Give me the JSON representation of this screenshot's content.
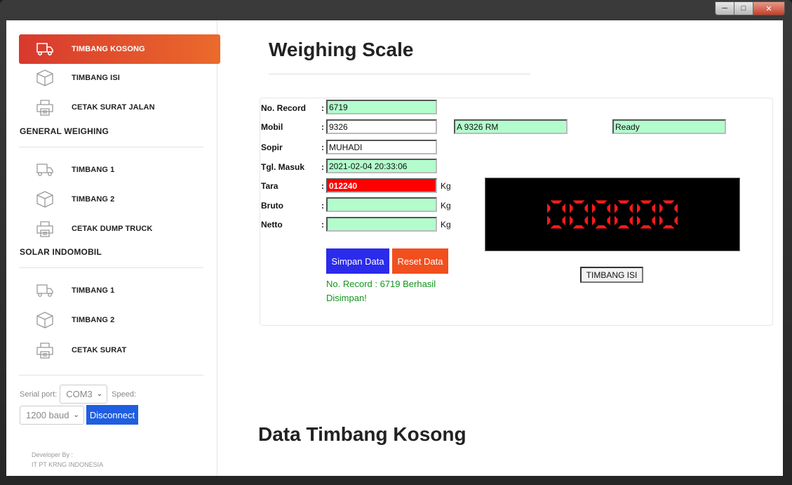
{
  "window": {
    "controls": [
      "minimize",
      "maximize",
      "close"
    ]
  },
  "sidebar": {
    "group1": [
      {
        "label": "TIMBANG KOSONG",
        "icon": "truck-icon",
        "active": true
      },
      {
        "label": "TIMBANG ISI",
        "icon": "box-icon",
        "active": false
      },
      {
        "label": "CETAK SURAT JALAN",
        "icon": "printer-icon",
        "active": false
      }
    ],
    "section_general": "GENERAL WEIGHING",
    "group2": [
      {
        "label": "TIMBANG 1",
        "icon": "truck-icon"
      },
      {
        "label": "TIMBANG 2",
        "icon": "box-icon"
      },
      {
        "label": "CETAK DUMP TRUCK",
        "icon": "printer-icon"
      }
    ],
    "section_solar": "SOLAR INDOMOBIL",
    "group3": [
      {
        "label": "TIMBANG 1",
        "icon": "truck-icon"
      },
      {
        "label": "TIMBANG 2",
        "icon": "box-icon"
      },
      {
        "label": "CETAK SURAT",
        "icon": "printer-icon"
      }
    ],
    "serial_label": "Serial port:",
    "serial_value": "COM3",
    "speed_label": "Speed:",
    "speed_value": "1200 baud",
    "disconnect_label": "Disconnect",
    "developer_by": "Developer By :",
    "developer_name": "IT PT KRNG INDONESIA"
  },
  "main": {
    "title": "Weighing Scale",
    "fields": {
      "no_record": {
        "label": "No. Record",
        "value": "6719"
      },
      "mobil": {
        "label": "Mobil",
        "value": "9326"
      },
      "sopir": {
        "label": "Sopir",
        "value": "MUHADI"
      },
      "tgl_masuk": {
        "label": "Tgl. Masuk",
        "value": "2021-02-04 20:33:06"
      },
      "tara": {
        "label": "Tara",
        "value": "012240",
        "unit": "Kg"
      },
      "bruto": {
        "label": "Bruto",
        "value": "",
        "unit": "Kg"
      },
      "netto": {
        "label": "Netto",
        "value": "",
        "unit": "Kg"
      }
    },
    "plate": "A 9326 RM",
    "status": "Ready",
    "save_button": "Simpan Data",
    "reset_button": "Reset Data",
    "message": "No. Record : 6719 Berhasil Disimpan!",
    "display_value": "000000",
    "display_color": "#ff1a1a",
    "isi_button": "TIMBANG ISI",
    "section_title": "Data Timbang Kosong"
  }
}
